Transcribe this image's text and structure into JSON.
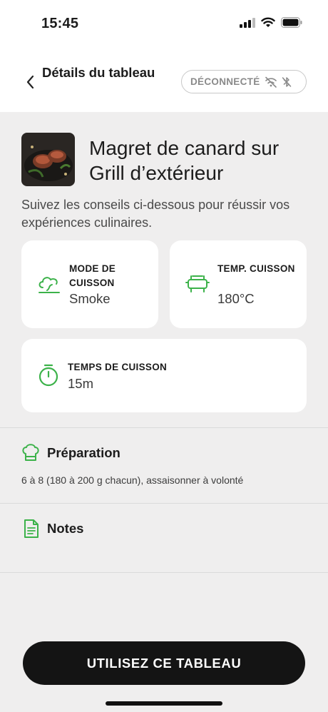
{
  "status": {
    "time": "15:45",
    "icons": [
      "signal-icon",
      "wifi-icon",
      "battery-icon"
    ]
  },
  "header": {
    "back_icon": "chevron-left-icon",
    "title": "Détails du tableau",
    "connection_status": "DÉCONNECTÉ",
    "connection_icons": [
      "wifi-off-icon",
      "bluetooth-off-icon"
    ]
  },
  "recipe": {
    "title": "Magret de canard sur Grill d’extérieur",
    "subtitle": "Suivez les conseils ci-dessous pour réussir vos expériences culinaires."
  },
  "settings": {
    "cook_mode_label": "MODE DE CUISSON",
    "cook_mode_value": "Smoke",
    "temp_label": "TEMP. CUISSON",
    "temp_value": "180°C",
    "time_label": "TEMPS DE CUISSON",
    "time_value": "15m"
  },
  "preparation": {
    "title": "Préparation",
    "text": "6 à 8 (180 à 200 g chacun), assaisonner à volonté"
  },
  "notes": {
    "title": "Notes"
  },
  "cta": {
    "label": "UTILISEZ CE TABLEAU"
  },
  "colors": {
    "accent_green": "#3cb24a",
    "background": "#efeeee",
    "cta_background": "#141414"
  }
}
